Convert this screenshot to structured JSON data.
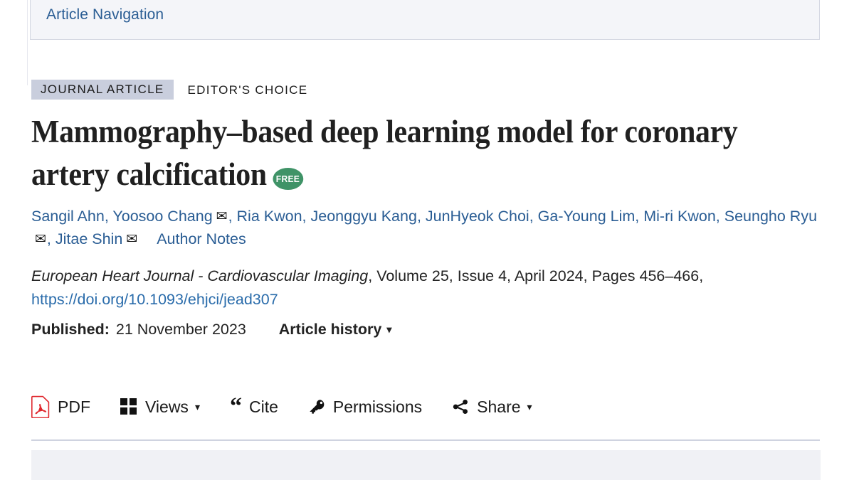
{
  "colors": {
    "link_blue": "#2a5d94",
    "doi_blue": "#2a6cab",
    "badge_bg": "#c9cedd",
    "free_green": "#3f9367",
    "pdf_red": "#e0282e",
    "nav_bg": "#f4f5f9",
    "panel_bg": "#f0f1f5"
  },
  "nav": {
    "link_label": "Article Navigation"
  },
  "badges": {
    "type": "JOURNAL ARTICLE",
    "editors_choice": "EDITOR'S CHOICE"
  },
  "article": {
    "title": "Mammography–based deep learning model for coronary artery calcification",
    "access_badge": "FREE"
  },
  "authors": {
    "list": [
      {
        "name": "Sangil Ahn",
        "corresponding": false
      },
      {
        "name": "Yoosoo Chang",
        "corresponding": true
      },
      {
        "name": "Ria Kwon",
        "corresponding": false
      },
      {
        "name": "Jeonggyu Kang",
        "corresponding": false
      },
      {
        "name": "JunHyeok Choi",
        "corresponding": false
      },
      {
        "name": "Ga-Young Lim",
        "corresponding": false
      },
      {
        "name": "Mi-ri Kwon",
        "corresponding": false
      },
      {
        "name": "Seungho Ryu",
        "corresponding": true
      },
      {
        "name": "Jitae Shin",
        "corresponding": true
      }
    ],
    "separator": ", ",
    "mail_icon": "envelope-icon",
    "author_notes_label": "Author Notes"
  },
  "citation": {
    "journal": "European Heart Journal - Cardiovascular Imaging",
    "volume": "Volume 25",
    "issue": "Issue 4",
    "date": "April 2024",
    "pages": "Pages 456–466",
    "doi_text": "https://doi.org/10.1093/ehjci/jead307",
    "full_text": ", Volume 25, Issue 4, April 2024, Pages 456–466, "
  },
  "published": {
    "label": "Published:",
    "date": "21 November 2023",
    "article_history_label": "Article history",
    "caret": "▾"
  },
  "toolbar": {
    "items": [
      {
        "label": "PDF",
        "icon": "pdf-icon",
        "caret": ""
      },
      {
        "label": "Views",
        "icon": "views-grid-icon",
        "caret": "▾"
      },
      {
        "label": "Cite",
        "icon": "quote-icon",
        "caret": ""
      },
      {
        "label": "Permissions",
        "icon": "key-icon",
        "caret": ""
      },
      {
        "label": "Share",
        "icon": "share-nodes-icon",
        "caret": "▾"
      }
    ]
  }
}
